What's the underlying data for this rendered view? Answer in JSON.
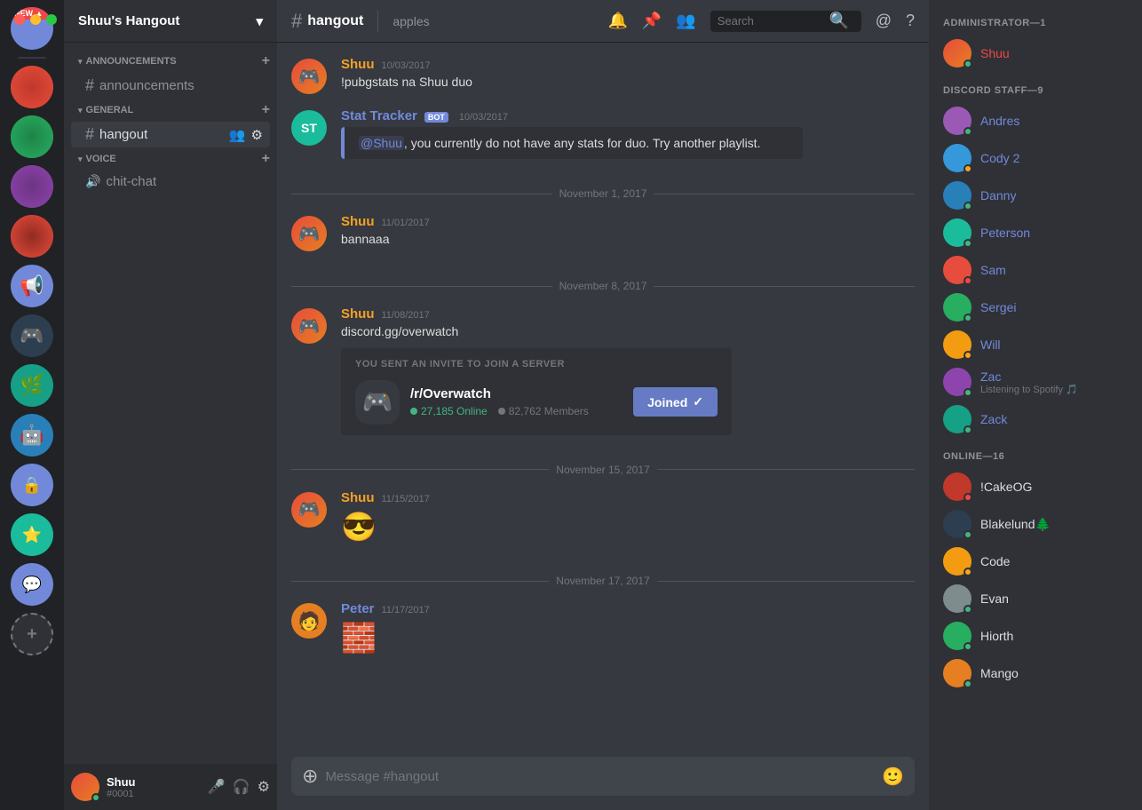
{
  "window": {
    "controls": [
      "close",
      "minimize",
      "maximize"
    ]
  },
  "server": {
    "name": "Shuu's Hangout",
    "dropdown_icon": "▾"
  },
  "channels": {
    "announcements_category": "ANNOUNCEMENTS",
    "general_category": "GENERAL",
    "voice_category": "VOICE",
    "active_channel": "hangout",
    "channel_topic": "apples",
    "items": [
      {
        "id": "announcements",
        "type": "text",
        "name": "announcements"
      },
      {
        "id": "hangout",
        "type": "text",
        "name": "hangout"
      },
      {
        "id": "chit-chat",
        "type": "voice",
        "name": "chit-chat"
      }
    ]
  },
  "topbar": {
    "hash": "#",
    "channel_name": "hangout",
    "topic": "apples",
    "search_placeholder": "Search"
  },
  "messages": [
    {
      "id": "msg1",
      "author": "Shuu",
      "author_color": "orange",
      "timestamp": "10/03/2017",
      "text": "!pubgstats na Shuu duo",
      "type": "normal"
    },
    {
      "id": "msg2",
      "author": "Stat Tracker",
      "author_color": "blue",
      "is_bot": true,
      "timestamp": "10/03/2017",
      "text": "@Shuu, you currently do not have any stats for duo. Try another playlist.",
      "type": "embed",
      "embed_text": "@Shuu, you currently do not have any stats for duo. Try another playlist."
    },
    {
      "id": "date1",
      "type": "date_divider",
      "text": "November 1, 2017"
    },
    {
      "id": "msg3",
      "author": "Shuu",
      "author_color": "orange",
      "timestamp": "11/01/2017",
      "text": "bannaaa",
      "type": "normal"
    },
    {
      "id": "date2",
      "type": "date_divider",
      "text": "November 8, 2017"
    },
    {
      "id": "msg4",
      "author": "Shuu",
      "author_color": "orange",
      "timestamp": "11/08/2017",
      "text": "discord.gg/overwatch",
      "type": "invite",
      "invite": {
        "label": "YOU SENT AN INVITE TO JOIN A SERVER",
        "server_name": "/r/Overwatch",
        "online_count": "27,185 Online",
        "member_count": "82,762 Members",
        "button_text": "Joined",
        "button_check": "✓"
      }
    },
    {
      "id": "date3",
      "type": "date_divider",
      "text": "November 15, 2017"
    },
    {
      "id": "msg5",
      "author": "Shuu",
      "author_color": "orange",
      "timestamp": "11/15/2017",
      "text": "😎",
      "type": "normal"
    },
    {
      "id": "date4",
      "type": "date_divider",
      "text": "November 17, 2017"
    },
    {
      "id": "msg6",
      "author": "Peter",
      "author_color": "blue",
      "timestamp": "11/17/2017",
      "text": "🧱",
      "type": "normal"
    }
  ],
  "message_input": {
    "placeholder": "Message #hangout"
  },
  "members": {
    "categories": [
      {
        "id": "administrator",
        "label": "ADMINISTRATOR—1",
        "members": [
          {
            "name": "Shuu",
            "color": "admin-red",
            "status": "online",
            "av": "av-shuu"
          }
        ]
      },
      {
        "id": "discord_staff",
        "label": "DISCORD STAFF—9",
        "members": [
          {
            "name": "Andres",
            "color": "staff-blue",
            "status": "online",
            "av": "av-andres"
          },
          {
            "name": "Cody 2",
            "color": "staff-blue",
            "status": "idle",
            "av": "av-cody"
          },
          {
            "name": "Danny",
            "color": "staff-blue",
            "status": "online",
            "av": "av-danny"
          },
          {
            "name": "Peterson",
            "color": "staff-blue",
            "status": "online",
            "av": "av-peterson"
          },
          {
            "name": "Sam",
            "color": "staff-blue",
            "status": "dnd",
            "av": "av-sam"
          },
          {
            "name": "Sergei",
            "color": "staff-blue",
            "status": "online",
            "av": "av-sergei"
          },
          {
            "name": "Will",
            "color": "staff-blue",
            "status": "idle",
            "av": "av-will"
          },
          {
            "name": "Zac",
            "color": "staff-blue",
            "status": "online",
            "av": "av-zac",
            "subtext": "Listening to Spotify 🎵"
          },
          {
            "name": "Zack",
            "color": "staff-blue",
            "status": "online",
            "av": "av-zack"
          }
        ]
      },
      {
        "id": "online",
        "label": "ONLINE—16",
        "members": [
          {
            "name": "!CakeOG",
            "color": "",
            "status": "dnd",
            "av": "av-cake"
          },
          {
            "name": "Blakelund🌲",
            "color": "",
            "status": "online",
            "av": "av-blake"
          },
          {
            "name": "Code",
            "color": "",
            "status": "idle",
            "av": "av-code"
          },
          {
            "name": "Evan",
            "color": "",
            "status": "online",
            "av": "av-evan"
          },
          {
            "name": "Hiorth",
            "color": "",
            "status": "online",
            "av": "av-hiorth"
          },
          {
            "name": "Mango",
            "color": "",
            "status": "online",
            "av": "av-mango"
          }
        ]
      }
    ]
  },
  "user": {
    "name": "Shuu",
    "discriminator": "#0001",
    "status": "online"
  }
}
